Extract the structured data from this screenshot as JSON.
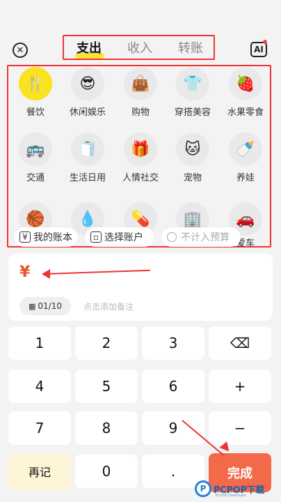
{
  "header": {
    "close_icon": "✕",
    "tabs": [
      {
        "label": "支出"
      },
      {
        "label": "收入"
      },
      {
        "label": "转账"
      }
    ],
    "ai_label": "AI"
  },
  "categories": [
    {
      "label": "餐饮",
      "icon": "🍴"
    },
    {
      "label": "休闲娱乐",
      "icon": "😎"
    },
    {
      "label": "购物",
      "icon": "👜"
    },
    {
      "label": "穿搭美容",
      "icon": "👕"
    },
    {
      "label": "水果零食",
      "icon": "🍓"
    },
    {
      "label": "交通",
      "icon": "🚌"
    },
    {
      "label": "生活日用",
      "icon": "🧻"
    },
    {
      "label": "人情社交",
      "icon": "🎁"
    },
    {
      "label": "宠物",
      "icon": "🐱"
    },
    {
      "label": "养娃",
      "icon": "🍼"
    },
    {
      "label": "",
      "icon": "🏀"
    },
    {
      "label": "",
      "icon": "💧"
    },
    {
      "label": "",
      "icon": "💊"
    },
    {
      "label": "",
      "icon": "🏢"
    },
    {
      "label": "爱车",
      "icon": "🚗"
    }
  ],
  "chips": {
    "ledger": "我的账本",
    "account": "选择账户",
    "budget": "不计入预算"
  },
  "amount": {
    "currency": "¥",
    "date": "01/10",
    "note_placeholder": "点击添加备注"
  },
  "keypad": {
    "k1": "1",
    "k2": "2",
    "k3": "3",
    "backspace": "⌫",
    "k4": "4",
    "k5": "5",
    "k6": "6",
    "plus": "+",
    "k7": "7",
    "k8": "8",
    "k9": "9",
    "minus": "−",
    "again": "再记",
    "k0": "0",
    "dot": ".",
    "done": "完成"
  },
  "watermark": {
    "logo": "P",
    "text": "PCPOP下载",
    "sub": "PCPOP Download"
  },
  "colors": {
    "accent_yellow": "#f9e21e",
    "done_orange": "#f36a4a",
    "currency_red": "#e8542b",
    "annotation_red": "#ee3333"
  }
}
